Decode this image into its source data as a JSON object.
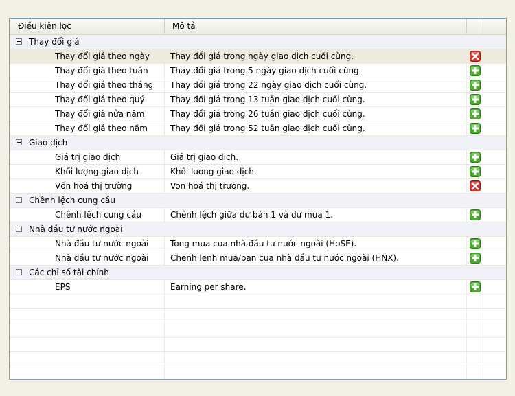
{
  "columns": [
    "Điều kiện lọc",
    "Mô tả"
  ],
  "groups": [
    {
      "label": "Thay đổi giá",
      "items": [
        {
          "name": "Thay đổi giá theo ngày",
          "desc": "Thay đổi giá trong ngày giao dịch cuối cùng.",
          "icon": "remove",
          "selected": true
        },
        {
          "name": "Thay đổi giá theo tuần",
          "desc": "Thay đổi giá trong 5 ngày giao dịch cuối cùng.",
          "icon": "add"
        },
        {
          "name": "Thay đổi giá theo tháng",
          "desc": "Thay đổi giá trong 22 ngày giao dịch cuối cùng.",
          "icon": "add"
        },
        {
          "name": "Thay đổi giá theo quý",
          "desc": "Thay đổi giá trong 13 tuần giao dịch cuối cùng.",
          "icon": "add"
        },
        {
          "name": "Thay đổi giá nửa năm",
          "desc": "Thay đổi giá trong 26 tuần giao dịch cuối cùng.",
          "icon": "add"
        },
        {
          "name": "Thay đổi giá theo năm",
          "desc": "Thay đổi giá trong 52 tuần giao dịch cuối cùng.",
          "icon": "add"
        }
      ]
    },
    {
      "label": "Giao dịch",
      "items": [
        {
          "name": "Giá trị giao dịch",
          "desc": "Giá trị giao dịch.",
          "icon": "add"
        },
        {
          "name": "Khối lượng giao dịch",
          "desc": "Khối lượng giao dịch.",
          "icon": "add"
        },
        {
          "name": "Vốn hoá thị trường",
          "desc": "Von hoá thị trường.",
          "icon": "remove"
        }
      ]
    },
    {
      "label": "Chênh lệch cung cầu",
      "items": [
        {
          "name": "Chênh lệch cung cầu",
          "desc": "Chênh lệch giữa dư bán 1 và dư mua 1.",
          "icon": "add"
        }
      ]
    },
    {
      "label": "Nhà đầu tư nước ngoài",
      "items": [
        {
          "name": "Nhà đầu tư nước ngoài",
          "desc": "Tong mua cua nhà đầu tư nước ngoài (HoSE).",
          "icon": "add"
        },
        {
          "name": "Nhà đầu tư nước ngoài",
          "desc": "Chenh lenh mua/ban cua nhà đầu tư nước ngoài (HNX).",
          "icon": "add"
        }
      ]
    },
    {
      "label": "Các chỉ số tài chính",
      "items": [
        {
          "name": "EPS",
          "desc": "Earning per share.",
          "icon": "add"
        }
      ]
    }
  ],
  "colors": {
    "add_green": "#4caa2e",
    "remove_red": "#d8312b",
    "group_bg": "#f1f2f7",
    "selected_bg": "#eeeade"
  }
}
